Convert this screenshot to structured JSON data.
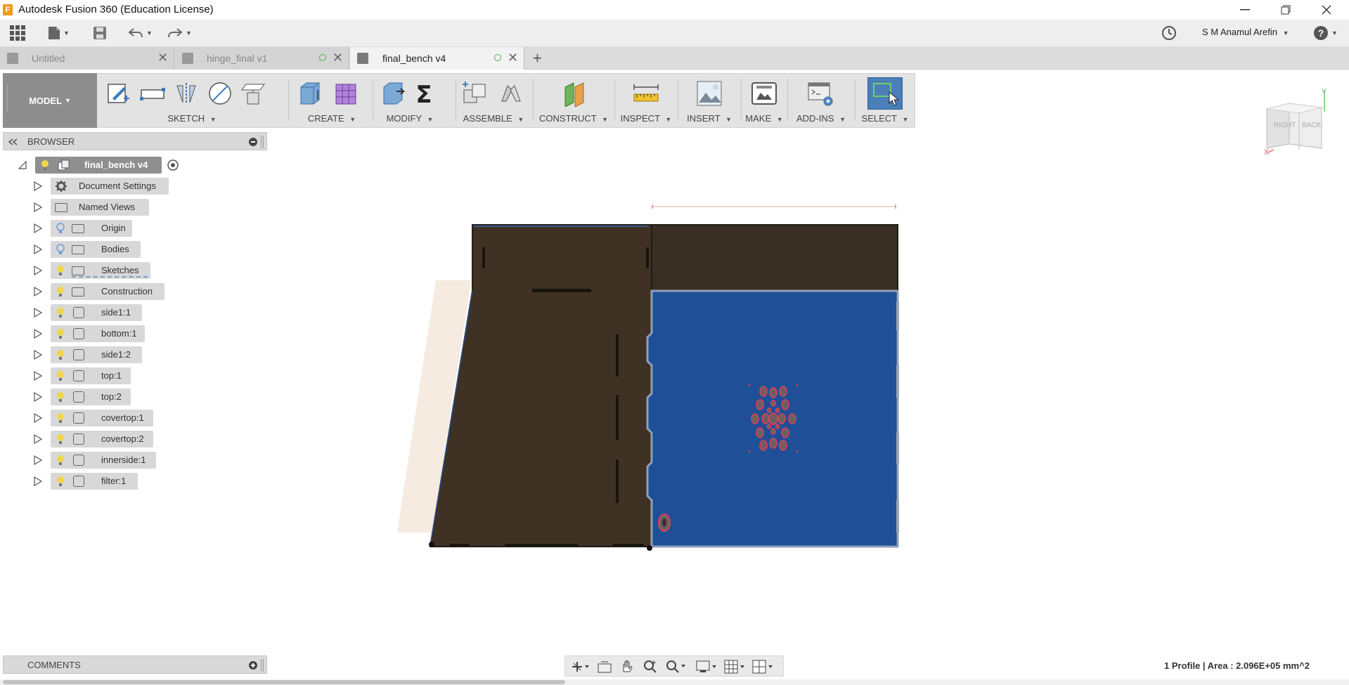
{
  "window": {
    "title": "Autodesk Fusion 360 (Education License)",
    "app_icon_letter": "F"
  },
  "quick_access": {
    "user_name": "S M Anamul Arefin"
  },
  "tabs": [
    {
      "label": "Untitled",
      "active": false
    },
    {
      "label": "hinge_final v1",
      "active": false
    },
    {
      "label": "final_bench v4",
      "active": true
    }
  ],
  "ribbon": {
    "workspace": "MODEL",
    "groups": [
      {
        "label": "SKETCH"
      },
      {
        "label": "CREATE"
      },
      {
        "label": "MODIFY"
      },
      {
        "label": "ASSEMBLE"
      },
      {
        "label": "CONSTRUCT"
      },
      {
        "label": "INSPECT"
      },
      {
        "label": "INSERT"
      },
      {
        "label": "MAKE"
      },
      {
        "label": "ADD-INS"
      },
      {
        "label": "SELECT"
      }
    ]
  },
  "browser": {
    "title": "BROWSER",
    "root": "final_bench v4",
    "items": [
      {
        "label": "Document Settings",
        "icon": "gear-icon"
      },
      {
        "label": "Named Views",
        "icon": "folder-icon"
      },
      {
        "label": "Origin",
        "icon": "folder-icon"
      },
      {
        "label": "Bodies",
        "icon": "folder-icon"
      },
      {
        "label": "Sketches",
        "icon": "folder-icon"
      },
      {
        "label": "Construction",
        "icon": "folder-icon"
      },
      {
        "label": "side1:1",
        "icon": "body-icon"
      },
      {
        "label": "bottom:1",
        "icon": "body-icon"
      },
      {
        "label": "side1:2",
        "icon": "body-icon"
      },
      {
        "label": "top:1",
        "icon": "body-icon"
      },
      {
        "label": "top:2",
        "icon": "body-icon"
      },
      {
        "label": "covertop:1",
        "icon": "body-icon"
      },
      {
        "label": "covertop:2",
        "icon": "body-icon"
      },
      {
        "label": "innerside:1",
        "icon": "body-icon"
      },
      {
        "label": "filter:1",
        "icon": "body-icon"
      }
    ]
  },
  "viewcube": {
    "faces": [
      "RIGHT",
      "BACK"
    ]
  },
  "comments": {
    "title": "COMMENTS"
  },
  "status": {
    "text": "1 Profile | Area : 2.096E+05 mm^2"
  },
  "colors": {
    "accent_blue": "#1f4f96",
    "panel_brown": "#3f3224",
    "select_blue": "#4a7fb8"
  }
}
